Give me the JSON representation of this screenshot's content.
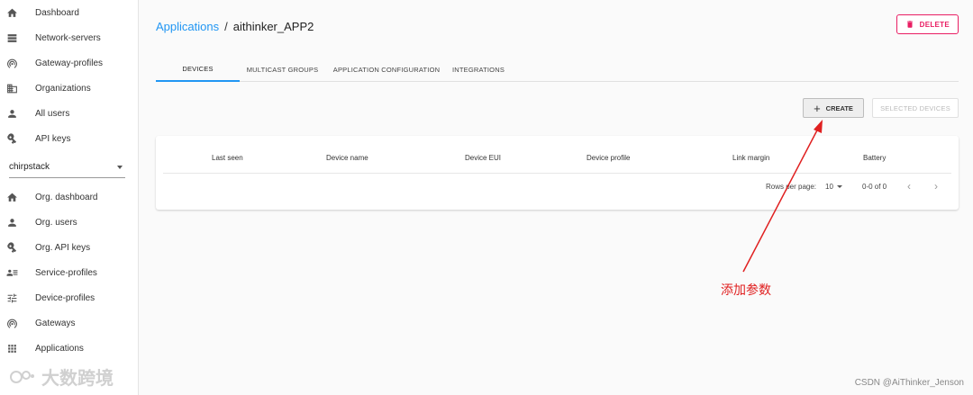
{
  "sidebar": {
    "top_items": [
      {
        "label": "Dashboard",
        "icon": "home-icon"
      },
      {
        "label": "Network-servers",
        "icon": "server-icon"
      },
      {
        "label": "Gateway-profiles",
        "icon": "gateway-icon"
      },
      {
        "label": "Organizations",
        "icon": "domain-icon"
      },
      {
        "label": "All users",
        "icon": "account-icon"
      },
      {
        "label": "API keys",
        "icon": "key-icon"
      }
    ],
    "org_select": {
      "value": "chirpstack"
    },
    "org_items": [
      {
        "label": "Org. dashboard",
        "icon": "home-icon"
      },
      {
        "label": "Org. users",
        "icon": "account-icon"
      },
      {
        "label": "Org. API keys",
        "icon": "key-icon"
      },
      {
        "label": "Service-profiles",
        "icon": "account-details-icon"
      },
      {
        "label": "Device-profiles",
        "icon": "tune-icon"
      },
      {
        "label": "Gateways",
        "icon": "gateway-icon"
      },
      {
        "label": "Applications",
        "icon": "apps-icon"
      }
    ]
  },
  "breadcrumb": {
    "parent": "Applications",
    "separator": "/",
    "current": "aithinker_APP2"
  },
  "header": {
    "delete_label": "DELETE"
  },
  "tabs": [
    {
      "label": "DEVICES",
      "active": true
    },
    {
      "label": "MULTICAST GROUPS",
      "active": false
    },
    {
      "label": "APPLICATION CONFIGURATION",
      "active": false
    },
    {
      "label": "INTEGRATIONS",
      "active": false
    }
  ],
  "toolbar": {
    "create_label": "CREATE",
    "selected_label": "SELECTED DEVICES"
  },
  "table": {
    "columns": [
      "Last seen",
      "Device name",
      "Device EUI",
      "Device profile",
      "Link margin",
      "Battery"
    ],
    "rows": [],
    "rows_per_page_label": "Rows per page:",
    "rows_per_page_value": "10",
    "range": "0-0 of 0"
  },
  "annotation": {
    "text": "添加参数",
    "color": "#e02020"
  },
  "watermarks": {
    "left": "大数跨境",
    "right": "CSDN @AiThinker_Jenson"
  },
  "colors": {
    "accent": "#2196f3",
    "danger": "#e91e63"
  }
}
